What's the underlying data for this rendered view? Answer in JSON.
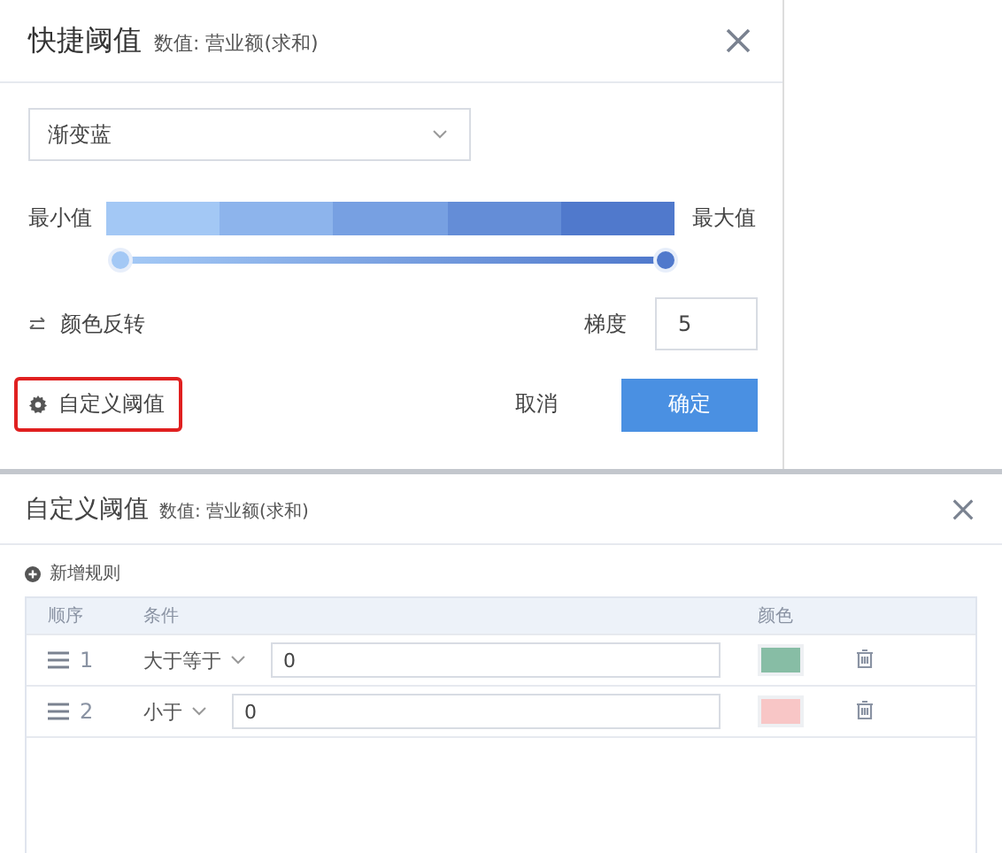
{
  "quick_dialog": {
    "title": "快捷阈值",
    "subtitle": "数值: 营业额(求和)",
    "scheme_select": {
      "value": "渐变蓝"
    },
    "gradient": {
      "min_label": "最小值",
      "max_label": "最大值",
      "segments": [
        {
          "color": "#a3c8f5"
        },
        {
          "color": "#8db4ec"
        },
        {
          "color": "#77a0e2"
        },
        {
          "color": "#648dd7"
        },
        {
          "color": "#5079cc"
        }
      ]
    },
    "range_slider": {
      "thumbs": [
        {
          "level": 0
        },
        {
          "level": 1
        }
      ]
    },
    "reverse": {
      "label": "颜色反转"
    },
    "steps": {
      "label": "梯度",
      "value": "5"
    },
    "custom_button": {
      "label": "自定义阈值",
      "highlighted": true
    },
    "buttons": [
      {
        "label": "取消",
        "kind": "secondary"
      },
      {
        "label": "确定",
        "kind": "primary"
      }
    ]
  },
  "custom_dialog": {
    "title": "自定义阈值",
    "subtitle": "数值: 营业额(求和)",
    "add_rule": "新增规则",
    "columns": [
      "顺序",
      "条件",
      "颜色"
    ],
    "rules": [
      {
        "order": "1",
        "condition": "大于等于",
        "value": "0",
        "color": "#87bda5"
      },
      {
        "order": "2",
        "condition": "小于",
        "value": "0",
        "color": "#f8c6c6"
      }
    ]
  }
}
